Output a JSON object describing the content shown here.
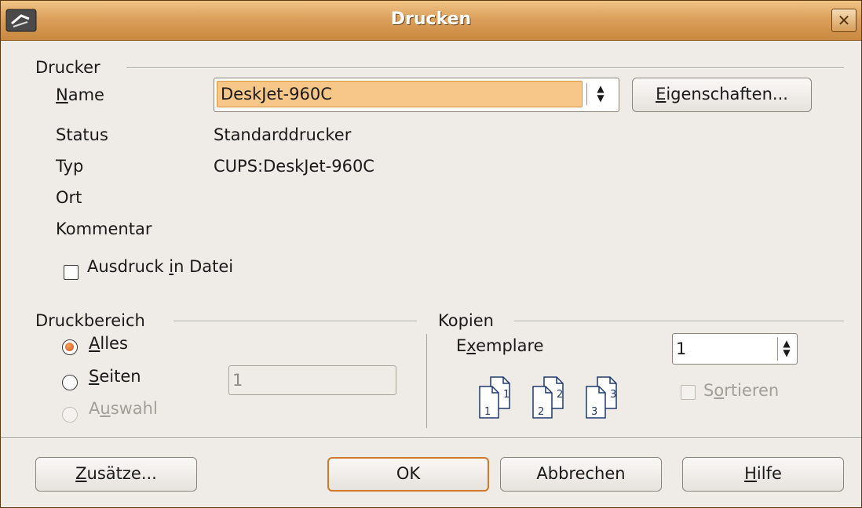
{
  "window": {
    "title": "Drucken"
  },
  "drucker": {
    "group_label": "Drucker",
    "name_label_pre": "",
    "name_label_u": "N",
    "name_label_post": "ame",
    "name_value": "DeskJet-960C",
    "properties_btn_u": "E",
    "properties_btn_post": "igenschaften...",
    "status_label": "Status",
    "status_value": "Standarddrucker",
    "typ_label": "Typ",
    "typ_value": "CUPS:DeskJet-960C",
    "ort_label": "Ort",
    "kommentar_label": "Kommentar",
    "print_to_file_pre": "Ausdruck ",
    "print_to_file_u": "i",
    "print_to_file_post": "n Datei",
    "print_to_file_checked": false
  },
  "druckbereich": {
    "group_label": "Druckbereich",
    "alles_u": "A",
    "alles_post": "lles",
    "seiten_u": "S",
    "seiten_post": "eiten",
    "seiten_value": "1",
    "auswahl_pre": "A",
    "auswahl_u": "u",
    "auswahl_post": "swahl",
    "selected": "Alles"
  },
  "kopien": {
    "group_label": "Kopien",
    "exemplare_pre": "E",
    "exemplare_u": "x",
    "exemplare_post": "emplare",
    "exemplare_value": "1",
    "sortieren_pre": "S",
    "sortieren_u": "o",
    "sortieren_post": "rtieren",
    "sortieren_checked": false,
    "collate_pages": [
      "1",
      "2",
      "3"
    ]
  },
  "buttons": {
    "zusaetze_u": "Z",
    "zusaetze_post": "usätze...",
    "ok": "OK",
    "abbrechen": "Abbrechen",
    "hilfe_u": "H",
    "hilfe_post": "ilfe"
  },
  "colors": {
    "titlebar": "#dba05c",
    "selection": "#f7c789",
    "radio_dot": "#d2561c",
    "default_border": "#d1782a"
  },
  "icons": [
    "app-icon",
    "close-icon",
    "spin-arrows-icon",
    "collate-pages-icon"
  ]
}
